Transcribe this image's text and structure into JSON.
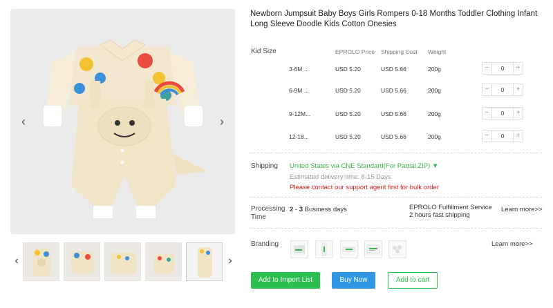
{
  "product": {
    "title": "Newborn Jumpsuit Baby Boys Girls Rompers 0-18 Months Toddler Clothing Infant Long Sleeve Doodle Kids Cotton Onesies"
  },
  "gallery": {
    "prev_icon": "chevron-left-icon",
    "next_icon": "chevron-right-icon",
    "thumbnail_count": 5
  },
  "variants": {
    "label": "Kid Size",
    "columns": [
      "EPROLO Price",
      "Shipping Cost",
      "Weight"
    ],
    "rows": [
      {
        "size": "3-6M ...",
        "price": "USD 5.20",
        "shipping": "USD 5.66",
        "weight": "200g",
        "qty": "0"
      },
      {
        "size": "6-9M ...",
        "price": "USD 5.20",
        "shipping": "USD 5.66",
        "weight": "200g",
        "qty": "0"
      },
      {
        "size": "9-12M...",
        "price": "USD 5.20",
        "shipping": "USD 5.66",
        "weight": "200g",
        "qty": "0"
      },
      {
        "size": "12-18...",
        "price": "USD 5.20",
        "shipping": "USD 5.66",
        "weight": "200g",
        "qty": "0"
      }
    ],
    "minus": "−",
    "plus": "+"
  },
  "shipping": {
    "label": "Shipping",
    "method": "United States via CNE Standard(For Partial ZIP) ▼",
    "delivery": "Estimated delivery time: 8-15 Days",
    "warning": "Please contact our support agent first for bulk order"
  },
  "processing": {
    "label_line1": "Processing",
    "label_line2": "Time",
    "days_from": "2",
    "sep": " - ",
    "days_to": "3",
    "unit": " Business days",
    "service_line1": "EPROLO Fulfillment Service",
    "service_line2": "2 hours fast shipping",
    "learn_more": "Learn more>>"
  },
  "branding": {
    "label": "Branding",
    "learn_more": "Learn more>>"
  },
  "actions": {
    "import": "Add to Import List",
    "buy": "Buy Now",
    "cart": "Add to cart"
  },
  "colors": {
    "green": "#2bbf4e",
    "blue": "#2f97e6",
    "red": "#e02020"
  }
}
